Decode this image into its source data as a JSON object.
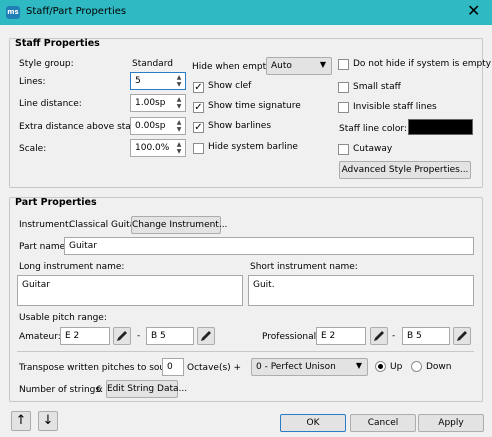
{
  "window": {
    "title": "Staff/Part Properties",
    "app_icon": "ms",
    "close_glyph": "✕"
  },
  "staff": {
    "title": "Staff Properties",
    "style_group_label": "Style group:",
    "style_group_value": "Standard",
    "lines_label": "Lines:",
    "lines_value": "5",
    "line_distance_label": "Line distance:",
    "line_distance_value": "1.00sp",
    "extra_distance_label": "Extra distance above staff:",
    "extra_distance_value": "0.00sp",
    "scale_label": "Scale:",
    "scale_value": "100.0%",
    "hide_when_empty_label": "Hide when empty:",
    "hide_when_empty_value": "Auto",
    "show_clef": {
      "label": "Show clef",
      "checked": true
    },
    "show_time_signature": {
      "label": "Show time signature",
      "checked": true
    },
    "show_barlines": {
      "label": "Show barlines",
      "checked": true
    },
    "hide_system_barline": {
      "label": "Hide system barline",
      "checked": false
    },
    "do_not_hide": {
      "label": "Do not hide if system is empty",
      "checked": false
    },
    "small_staff": {
      "label": "Small staff",
      "checked": false
    },
    "invisible_staff_lines": {
      "label": "Invisible staff lines",
      "checked": false
    },
    "staff_line_color_label": "Staff line color:",
    "staff_line_color": "#000000",
    "cutaway": {
      "label": "Cutaway",
      "checked": false
    },
    "advanced_button": "Advanced Style Properties..."
  },
  "part": {
    "title": "Part Properties",
    "instrument_label": "Instrument:",
    "instrument_value": "Classical Guitar",
    "change_instrument_button": "Change Instrument...",
    "part_name_label": "Part name:",
    "part_name_value": "Guitar",
    "long_name_label": "Long instrument name:",
    "long_name_value": "Guitar",
    "short_name_label": "Short instrument name:",
    "short_name_value": "Guit.",
    "usable_range_label": "Usable pitch range:",
    "amateur_label": "Amateur:",
    "amateur_low": "E 2",
    "amateur_high": "B 5",
    "professional_label": "Professional:",
    "professional_low": "E 2",
    "professional_high": "B 5",
    "range_dash": "-",
    "transpose_label": "Transpose written pitches to sound:",
    "transpose_octaves": "0",
    "octaves_label": "Octave(s) +",
    "interval_value": "0 - Perfect Unison",
    "up_label": "Up",
    "down_label": "Down",
    "direction": "up",
    "strings_label": "Number of strings:",
    "strings_value": "6",
    "edit_strings_button": "Edit String Data..."
  },
  "footer": {
    "up_arrow": "↑",
    "down_arrow": "↓",
    "ok": "OK",
    "cancel": "Cancel",
    "apply": "Apply"
  },
  "colors": {
    "titlebar": "#2fb9c2",
    "focus": "#2a7cc7"
  }
}
